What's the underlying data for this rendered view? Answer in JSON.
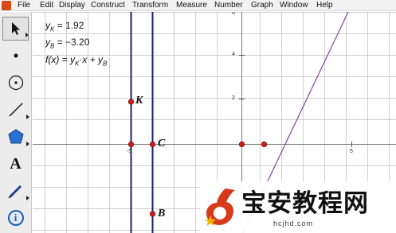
{
  "menu": {
    "items": [
      "File",
      "Edit",
      "Display",
      "Construct",
      "Transform",
      "Measure",
      "Number",
      "Graph",
      "Window",
      "Help"
    ]
  },
  "toolbox": {
    "tools": [
      {
        "name": "arrow-select-tool",
        "icon": "arrow-icon",
        "selected": true
      },
      {
        "name": "point-tool",
        "icon": "point-icon"
      },
      {
        "name": "compass-tool",
        "icon": "compass-circle-icon"
      },
      {
        "name": "straightedge-tool",
        "icon": "line-segment-icon"
      },
      {
        "name": "polygon-tool",
        "icon": "polygon-icon"
      },
      {
        "name": "text-tool",
        "icon": "text-a-icon",
        "glyph": "A"
      },
      {
        "name": "marker-tool",
        "icon": "marker-pen-icon"
      },
      {
        "name": "information-tool",
        "icon": "info-icon",
        "glyph": "i"
      }
    ]
  },
  "measurements": {
    "yk": {
      "label": "y",
      "sub": "K",
      "value": " = 1.92"
    },
    "yb": {
      "label": "y",
      "sub": "B",
      "value": " = −3.20"
    },
    "func": {
      "text": "f(x) = y",
      "sub1": "K",
      "mid": "·x + y",
      "sub2": "B"
    }
  },
  "graph": {
    "ticks": {
      "x": [
        "-5",
        "5"
      ],
      "y": [
        "6",
        "4",
        "2"
      ]
    },
    "points": {
      "K": "K",
      "C": "C",
      "B": "B"
    },
    "colors": {
      "grid": "#bcbcbc",
      "axes": "#7a7a7a",
      "vlines": "#1b1f7a",
      "point": "#d11a1a",
      "function": "#8a3fa8"
    }
  },
  "watermark": {
    "text": "宝安教程网",
    "sub": "hcjhd.com"
  }
}
